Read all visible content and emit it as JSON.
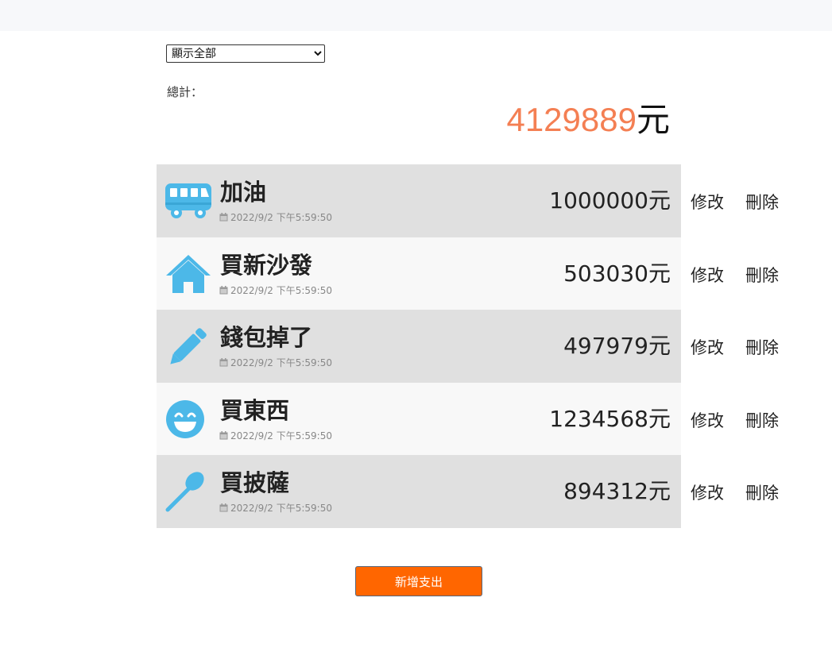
{
  "filter": {
    "selected": "顯示全部",
    "options": [
      "顯示全部"
    ]
  },
  "total": {
    "label": "總計：",
    "value": "4129889",
    "unit": "元"
  },
  "colors": {
    "accent": "#4cb8e8",
    "total_value": "#f47f53",
    "add_button": "#ff6600"
  },
  "expenses": [
    {
      "title": "加油",
      "icon": "bus-icon",
      "date": "2022/9/2 下午5:59:50",
      "amount": "1000000元",
      "edit_label": "修改",
      "delete_label": "刪除"
    },
    {
      "title": "買新沙發",
      "icon": "home-icon",
      "date": "2022/9/2 下午5:59:50",
      "amount": "503030元",
      "edit_label": "修改",
      "delete_label": "刪除"
    },
    {
      "title": "錢包掉了",
      "icon": "pencil-icon",
      "date": "2022/9/2 下午5:59:50",
      "amount": "497979元",
      "edit_label": "修改",
      "delete_label": "刪除"
    },
    {
      "title": "買東西",
      "icon": "smile-icon",
      "date": "2022/9/2 下午5:59:50",
      "amount": "1234568元",
      "edit_label": "修改",
      "delete_label": "刪除"
    },
    {
      "title": "買披薩",
      "icon": "spoon-icon",
      "date": "2022/9/2 下午5:59:50",
      "amount": "894312元",
      "edit_label": "修改",
      "delete_label": "刪除"
    }
  ],
  "add_button": {
    "label": "新增支出"
  }
}
